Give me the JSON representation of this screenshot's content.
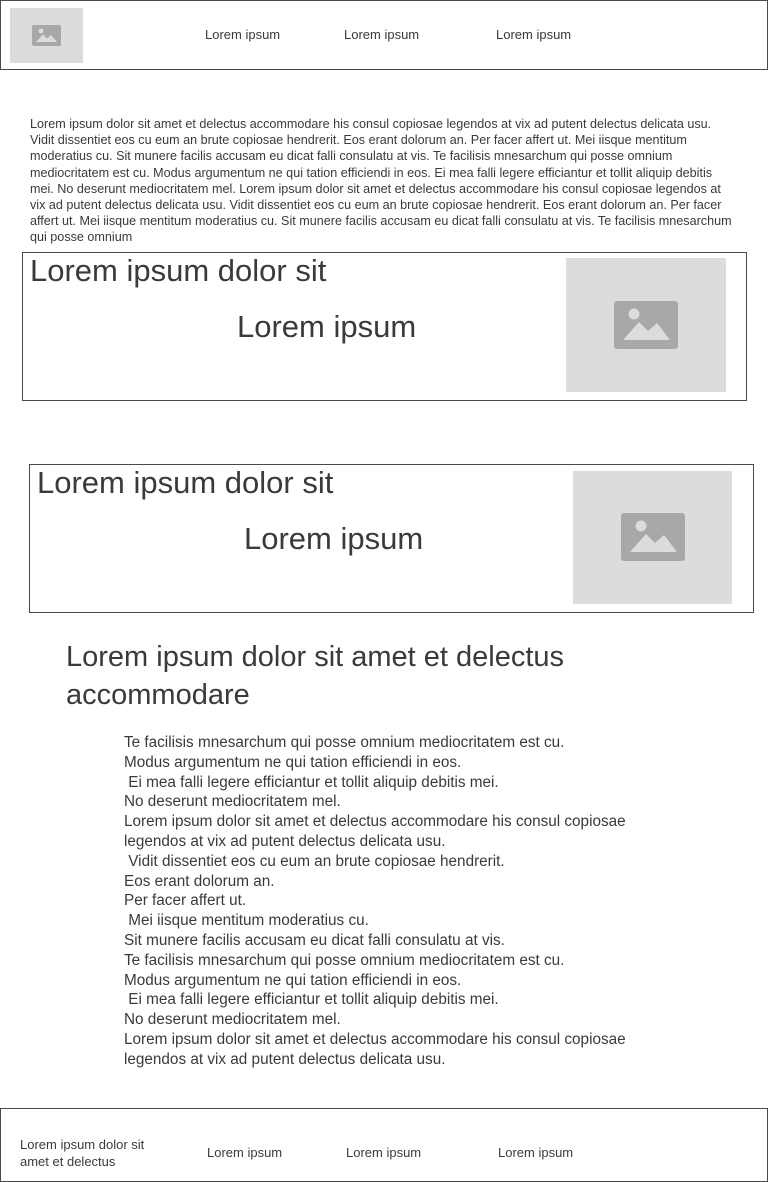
{
  "header": {
    "logo_icon": "image-icon",
    "nav": [
      "Lorem ipsum",
      "Lorem ipsum",
      "Lorem ipsum"
    ]
  },
  "intro": {
    "text": "Lorem ipsum dolor sit amet et delectus accommodare his consul copiosae legendos at vix ad putent delectus delicata usu. Vidit dissentiet eos cu eum an brute copiosae hendrerit. Eos erant dolorum an. Per facer affert ut. Mei iisque mentitum moderatius cu. Sit munere facilis accusam eu dicat falli consulatu at vis. Te facilisis mnesarchum qui posse omnium mediocritatem est cu. Modus argumentum ne qui tation efficiendi in eos. Ei mea falli legere efficiantur et tollit aliquip debitis mei. No deserunt mediocritatem mel. Lorem ipsum dolor sit amet et delectus accommodare his consul copiosae legendos at vix ad putent delectus delicata usu. Vidit dissentiet eos cu eum an brute copiosae hendrerit. Eos erant dolorum an. Per facer affert ut. Mei iisque mentitum moderatius cu. Sit munere facilis accusam eu dicat falli consulatu at vis. Te facilisis mnesarchum qui posse omnium"
  },
  "cards": [
    {
      "title": "Lorem ipsum dolor sit",
      "subtitle": "Lorem ipsum",
      "image_icon": "image-icon"
    },
    {
      "title": "Lorem ipsum dolor sit",
      "subtitle": "Lorem ipsum",
      "image_icon": "image-icon"
    }
  ],
  "section": {
    "title": "Lorem ipsum dolor sit amet et delectus accommodare",
    "lines": [
      "Te facilisis mnesarchum qui posse omnium mediocritatem est cu.",
      "Modus argumentum ne qui tation efficiendi in eos.",
      " Ei mea falli legere efficiantur et tollit aliquip debitis mei.",
      "No deserunt mediocritatem mel.",
      "Lorem ipsum dolor sit amet et delectus accommodare his consul copiosae",
      "legendos at vix ad putent delectus delicata usu.",
      " Vidit dissentiet eos cu eum an brute copiosae hendrerit.",
      "Eos erant dolorum an.",
      "Per facer affert ut.",
      " Mei iisque mentitum moderatius cu.",
      "Sit munere facilis accusam eu dicat falli consulatu at vis.",
      "Te facilisis mnesarchum qui posse omnium mediocritatem est cu.",
      "Modus argumentum ne qui tation efficiendi in eos.",
      " Ei mea falli legere efficiantur et tollit aliquip debitis mei.",
      "No deserunt mediocritatem mel.",
      "Lorem ipsum dolor sit amet et delectus accommodare his consul copiosae",
      "legendos at vix ad putent delectus delicata usu."
    ]
  },
  "footer": {
    "brand": "Lorem ipsum dolor sit amet et delectus",
    "nav": [
      "Lorem ipsum",
      "Lorem ipsum",
      "Lorem ipsum"
    ]
  },
  "colors": {
    "placeholder_bg": "#dcdcdc",
    "placeholder_icon": "#a8a8a8",
    "border": "#4a4a4a",
    "text": "#3a3a3a"
  }
}
